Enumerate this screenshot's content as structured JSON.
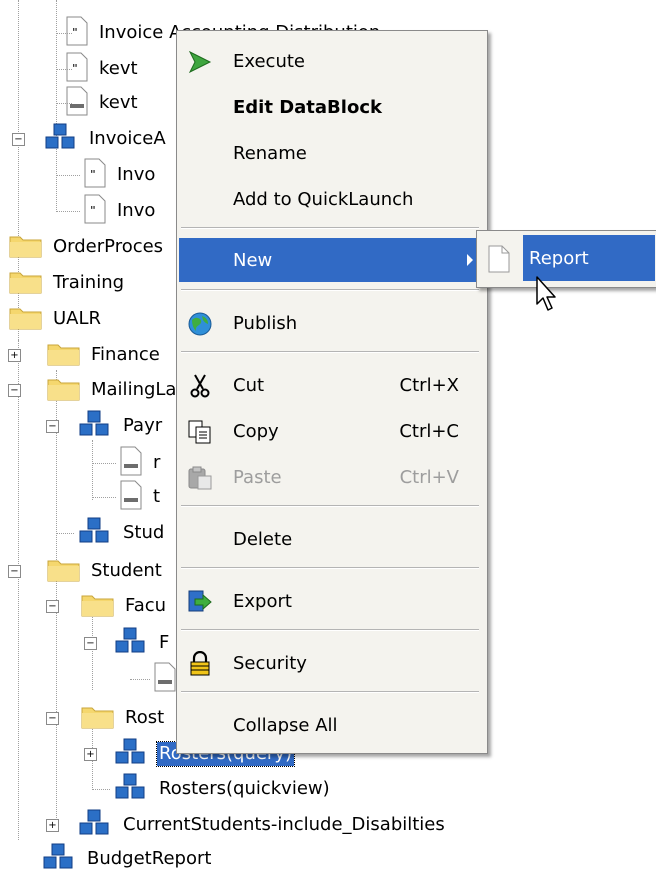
{
  "tree": {
    "rows": [
      {
        "label": "Invoice Accounting Distribution"
      },
      {
        "label": "kevt"
      },
      {
        "label": "kevt"
      },
      {
        "label": "InvoiceA"
      },
      {
        "label": "Invo"
      },
      {
        "label": "Invo"
      },
      {
        "label": "OrderProces"
      },
      {
        "label": "Training"
      },
      {
        "label": "UALR"
      },
      {
        "label": "Finance"
      },
      {
        "label": "MailingLa"
      },
      {
        "label": "Payr"
      },
      {
        "label": "r"
      },
      {
        "label": "t"
      },
      {
        "label": "Stud"
      },
      {
        "label": "Student"
      },
      {
        "label": "Facu"
      },
      {
        "label": "F"
      },
      {
        "label": ""
      },
      {
        "label": "Rost"
      },
      {
        "label": "Rosters(query)"
      },
      {
        "label": "Rosters(quickview)"
      },
      {
        "label": "CurrentStudents-include_Disabilties"
      },
      {
        "label": "BudgetReport"
      }
    ],
    "selected_label": "Rosters(query)"
  },
  "context_menu": {
    "items": [
      {
        "label": "Execute",
        "icon": "execute-arrow-icon"
      },
      {
        "label": "Edit DataBlock"
      },
      {
        "label": "Rename"
      },
      {
        "label": "Add to QuickLaunch"
      },
      {
        "label": "New",
        "has_submenu": true
      },
      {
        "label": "Publish",
        "icon": "publish-globe-icon"
      },
      {
        "label": "Cut",
        "shortcut": "Ctrl+X",
        "icon": "scissors-icon"
      },
      {
        "label": "Copy",
        "shortcut": "Ctrl+C",
        "icon": "copy-icon"
      },
      {
        "label": "Paste",
        "shortcut": "Ctrl+V",
        "icon": "paste-icon",
        "disabled": true
      },
      {
        "label": "Delete"
      },
      {
        "label": "Export",
        "icon": "export-icon"
      },
      {
        "label": "Security",
        "icon": "padlock-icon"
      },
      {
        "label": "Collapse All"
      }
    ]
  },
  "submenu": {
    "items": [
      {
        "label": "Report",
        "icon": "blank-page-icon"
      }
    ]
  },
  "colors": {
    "highlight": "#316ac5",
    "menu_bg": "#f4f3ee",
    "folder": "#f5d76e",
    "datablock_blue": "#2b6fc6"
  }
}
